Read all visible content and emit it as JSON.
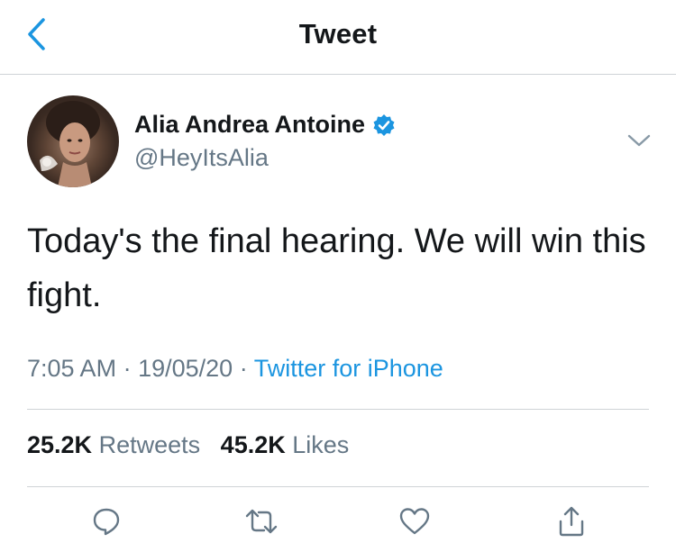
{
  "nav": {
    "title": "Tweet",
    "back_icon": "chevron-left-icon"
  },
  "colors": {
    "accent": "#1b95e0",
    "text_primary": "#14171a",
    "text_secondary": "#657786",
    "divider": "#cfd3d6"
  },
  "tweet": {
    "author": {
      "name": "Alia Andrea Antoine",
      "handle": "@HeyItsAlia",
      "verified": true
    },
    "text": "Today's the final hearing. We will win this fight.",
    "time": "7:05 AM",
    "date": "19/05/20",
    "source": "Twitter for iPhone",
    "separator": "·"
  },
  "stats": {
    "retweets_count": "25.2K",
    "retweets_label": "Retweets",
    "likes_count": "45.2K",
    "likes_label": "Likes"
  },
  "actions": [
    {
      "name": "reply",
      "icon": "reply-icon"
    },
    {
      "name": "retweet",
      "icon": "retweet-icon"
    },
    {
      "name": "like",
      "icon": "heart-icon"
    },
    {
      "name": "share",
      "icon": "share-icon"
    }
  ]
}
